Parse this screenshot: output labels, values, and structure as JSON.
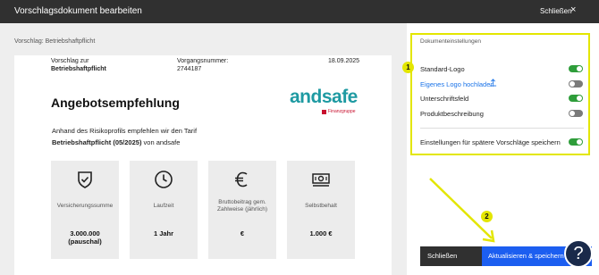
{
  "titlebar": {
    "title": "Vorschlagsdokument bearbeiten",
    "close_label": "Schließen",
    "close_icon": "×"
  },
  "breadcrumb": "Vorschlag: Betriebshaftpflicht",
  "document": {
    "proposal_label": "Vorschlag zur",
    "proposal_value": "Betriebshaftpflicht",
    "process_label": "Vorgangsnummer:",
    "process_value": "2744187",
    "date": "18.09.2025",
    "heading": "Angebotsempfehlung",
    "logo_text": "andsafe",
    "logo_sub": "Finanzgruppe",
    "intro_line1": "Anhand des Risikoprofils empfehlen wir den Tarif",
    "intro_tariff": "Betriebshaftpflicht (05/2025)",
    "intro_suffix": " von andsafe",
    "cards": [
      {
        "icon": "shield-check-icon",
        "label": "Versicherungssumme",
        "value": "3.000.000\n(pauschal)"
      },
      {
        "icon": "clock-icon",
        "label": "Laufzeit",
        "value": "1 Jahr"
      },
      {
        "icon": "euro-icon",
        "label": "Bruttobeitrag gem.\nZahlweise (jährlich)",
        "value": "€"
      },
      {
        "icon": "banknote-icon",
        "label": "Selbstbehalt",
        "value": "1.000 €"
      }
    ]
  },
  "settings": {
    "title": "Dokumenteinstellungen",
    "rows": [
      {
        "label": "Standard-Logo",
        "on": true
      },
      {
        "label": "Eigenes Logo hochladen",
        "on": false,
        "link": true
      },
      {
        "label": "Unterschriftsfeld",
        "on": true
      },
      {
        "label": "Produktbeschreibung",
        "on": false
      }
    ],
    "save_for_later": {
      "label": "Einstellungen für spätere Vorschläge speichern",
      "on": true
    }
  },
  "annotations": {
    "badge1": "1",
    "badge2": "2"
  },
  "footer": {
    "close_label": "Schließen",
    "save_label": "Aktualisieren & speichern",
    "help_label": "?"
  },
  "colors": {
    "accent_blue": "#1c5ef0",
    "toggle_on": "#2e9d3a",
    "toggle_off": "#7a7a7a",
    "highlight": "#e3e600",
    "logo": "#1e9aa2"
  }
}
